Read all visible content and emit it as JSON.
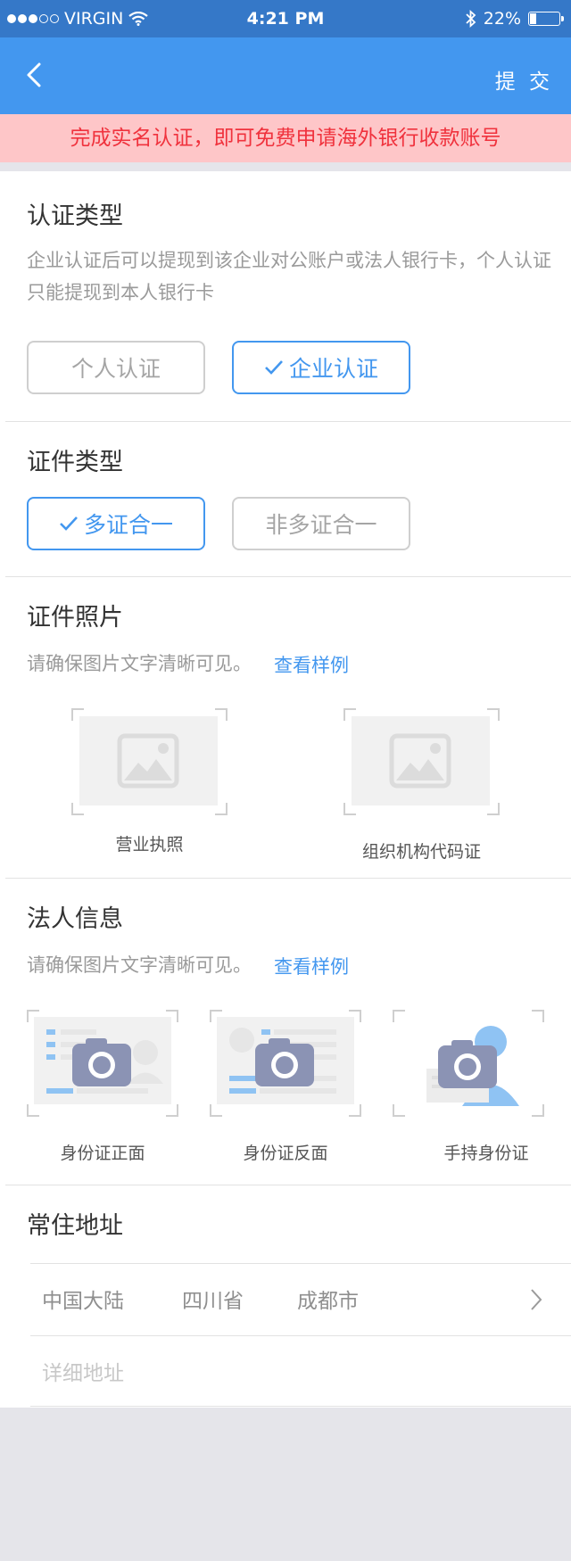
{
  "status_bar": {
    "carrier": "VIRGIN",
    "time": "4:21 PM",
    "battery": "22%",
    "battery_level": 0.22
  },
  "nav": {
    "submit_label": "提 交"
  },
  "banner": "完成实名认证，即可免费申请海外银行收款账号",
  "auth_type": {
    "title": "认证类型",
    "description": "企业认证后可以提现到该企业对公账户或法人银行卡，个人认证只能提现到本人银行卡",
    "options": [
      {
        "label": "个人认证",
        "selected": false
      },
      {
        "label": "企业认证",
        "selected": true
      }
    ]
  },
  "cert_type": {
    "title": "证件类型",
    "options": [
      {
        "label": "多证合一",
        "selected": true
      },
      {
        "label": "非多证合一",
        "selected": false
      }
    ]
  },
  "cert_photos": {
    "title": "证件照片",
    "hint": "请确保图片文字清晰可见。",
    "example_link": "查看样例",
    "items": [
      "营业执照",
      "组织机构代码证"
    ]
  },
  "legal_person": {
    "title": "法人信息",
    "hint": "请确保图片文字清晰可见。",
    "example_link": "查看样例",
    "items": [
      "身份证正面",
      "身份证反面",
      "手持身份证"
    ]
  },
  "address": {
    "title": "常住地址",
    "country": "中国大陆",
    "province": "四川省",
    "city": "成都市",
    "detail_placeholder": "详细地址"
  },
  "colors": {
    "accent": "#4397ef",
    "status_bar": "#3578c8",
    "banner_bg": "#fec6c8",
    "banner_text": "#f0323d"
  }
}
